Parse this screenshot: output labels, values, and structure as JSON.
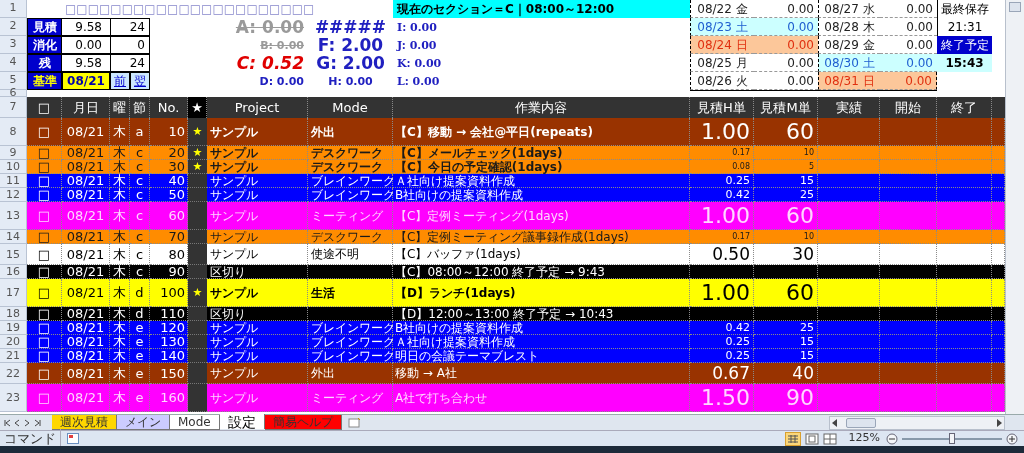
{
  "top_row_numbers": [
    "1",
    "2",
    "3",
    "4",
    "5",
    "6"
  ],
  "checkbox_strip": "□□□□□□□□□□□□□□□□□□□□□□",
  "current_section": "現在のセクション＝C｜08:00～12:00",
  "summary": [
    {
      "label": "見積",
      "hours": "9.58",
      "minutes": "24"
    },
    {
      "label": "消化",
      "hours": "0.00",
      "minutes": "0"
    },
    {
      "label": "残",
      "hours": "9.58",
      "minutes": "24"
    }
  ],
  "base": {
    "label": "基準",
    "date": "08/21",
    "prev": "前",
    "next": "翌"
  },
  "section_totals": [
    [
      {
        "text": "A: 0.00",
        "kind": "done",
        "large": true
      },
      {
        "text": "B: 0.00",
        "kind": "done",
        "large": false
      },
      {
        "text": "C: 0.52",
        "kind": "current",
        "large": true
      },
      {
        "text": "D: 0.00",
        "kind": "pending",
        "large": false
      }
    ],
    [
      {
        "text": "#####",
        "kind": "pending",
        "large": true
      },
      {
        "text": "F: 2.00",
        "kind": "pending",
        "large": true
      },
      {
        "text": "G: 2.00",
        "kind": "pending",
        "large": true
      },
      {
        "text": "H: 0.00",
        "kind": "pending",
        "large": false
      }
    ],
    [
      {
        "text": "I: 0.00",
        "kind": "pending",
        "large": false
      },
      {
        "text": "J: 0.00",
        "kind": "pending",
        "large": false
      },
      {
        "text": "K: 0.00",
        "kind": "pending",
        "large": false
      },
      {
        "text": "L: 0.00",
        "kind": "pending",
        "large": false
      }
    ]
  ],
  "calendar": [
    {
      "date": "08/22 金",
      "value": "0.00",
      "kind": "weekday"
    },
    {
      "date": "08/23 土",
      "value": "0.00",
      "kind": "saturday"
    },
    {
      "date": "08/24 日",
      "value": "0.00",
      "kind": "sunday"
    },
    {
      "date": "08/25 月",
      "value": "0.00",
      "kind": "weekday"
    },
    {
      "date": "08/26 火",
      "value": "0.00",
      "kind": "weekday"
    },
    {
      "date": "08/27 水",
      "value": "0.00",
      "kind": "weekday"
    },
    {
      "date": "08/28 木",
      "value": "0.00",
      "kind": "weekday"
    },
    {
      "date": "08/29 金",
      "value": "0.00",
      "kind": "weekday"
    },
    {
      "date": "08/30 土",
      "value": "0.00",
      "kind": "saturday"
    },
    {
      "date": "08/31 日",
      "value": "0.00",
      "kind": "sunday"
    }
  ],
  "last_saved": {
    "label": "最終保存",
    "time": "21:31"
  },
  "end_estimate": {
    "label": "終了予定",
    "time": "15:43"
  },
  "table": {
    "row_number": "7",
    "columns": [
      "□",
      "月日",
      "曜",
      "節",
      "No.",
      "★",
      "Project",
      "Mode",
      "作業内容",
      "見積H単",
      "見積M単",
      "実績",
      "開始",
      "終了"
    ],
    "rows": [
      {
        "row": "8",
        "check": "□",
        "date": "08/21",
        "dow": "木",
        "sect": "a",
        "no": "10",
        "star": "★",
        "project": "サンプル",
        "mode": "外出",
        "content": "【C】移動 → 会社@平日(repeats)",
        "est_h": "1.00",
        "est_m": "60",
        "kind": "outing",
        "large": true,
        "medium": false,
        "small": false,
        "bold": true
      },
      {
        "row": "9",
        "check": "□",
        "date": "08/21",
        "dow": "木",
        "sect": "c",
        "no": "20",
        "star": "★",
        "project": "サンプル",
        "mode": "デスクワーク",
        "content": "【C】メールチェック(1days)",
        "est_h": "0.17",
        "est_m": "10",
        "kind": "desk",
        "large": false,
        "medium": false,
        "small": true,
        "bold": true
      },
      {
        "row": "10",
        "check": "□",
        "date": "08/21",
        "dow": "木",
        "sect": "c",
        "no": "30",
        "star": "★",
        "project": "サンプル",
        "mode": "デスクワーク",
        "content": "【C】今日の予定確認(1days)",
        "est_h": "0.08",
        "est_m": "5",
        "kind": "desk",
        "large": false,
        "medium": false,
        "small": true,
        "bold": true
      },
      {
        "row": "11",
        "check": "□",
        "date": "08/21",
        "dow": "木",
        "sect": "c",
        "no": "40",
        "project": "サンプル",
        "mode": "ブレインワーク",
        "content": "Ａ社向け提案資料作成",
        "est_h": "0.25",
        "est_m": "15",
        "kind": "brain",
        "large": false,
        "medium": false,
        "small": false,
        "bold": false
      },
      {
        "row": "12",
        "check": "□",
        "date": "08/21",
        "dow": "木",
        "sect": "c",
        "no": "50",
        "project": "サンプル",
        "mode": "ブレインワーク",
        "content": "B社向けの提案資料作成",
        "est_h": "0.42",
        "est_m": "25",
        "kind": "brain",
        "large": false,
        "medium": false,
        "small": false,
        "bold": false
      },
      {
        "row": "13",
        "check": "□",
        "date": "08/21",
        "dow": "木",
        "sect": "c",
        "no": "60",
        "project": "サンプル",
        "mode": "ミーティング",
        "content": "【C】定例ミーティング(1days)",
        "est_h": "1.00",
        "est_m": "60",
        "kind": "meeting",
        "large": true,
        "medium": false,
        "small": false,
        "bold": false
      },
      {
        "row": "14",
        "check": "□",
        "date": "08/21",
        "dow": "木",
        "sect": "c",
        "no": "70",
        "project": "サンプル",
        "mode": "デスクワーク",
        "content": "【C】定例ミーティング議事録作成(1days)",
        "est_h": "0.17",
        "est_m": "10",
        "kind": "desk",
        "large": false,
        "medium": false,
        "small": true,
        "bold": false
      },
      {
        "row": "15",
        "check": "□",
        "date": "08/21",
        "dow": "木",
        "sect": "c",
        "no": "80",
        "project": "サンプル",
        "mode": "使途不明",
        "content": "【C】バッファ(1days)",
        "est_h": "0.50",
        "est_m": "30",
        "kind": "misc",
        "large": false,
        "medium": true,
        "small": false,
        "bold": false
      },
      {
        "row": "16",
        "check": "□",
        "date": "08/21",
        "dow": "木",
        "sect": "c",
        "no": "90",
        "project": "区切り",
        "content": "【C】08:00～12:00 終了予定 → 9:43",
        "kind": "separator",
        "bold": false
      },
      {
        "row": "17",
        "check": "□",
        "date": "08/21",
        "dow": "木",
        "sect": "d",
        "no": "100",
        "star": "★",
        "project": "サンプル",
        "mode": "生活",
        "content": "【D】ランチ(1days)",
        "est_h": "1.00",
        "est_m": "60",
        "kind": "life",
        "large": true,
        "medium": false,
        "small": false,
        "bold": true
      },
      {
        "row": "18",
        "check": "□",
        "date": "08/21",
        "dow": "木",
        "sect": "d",
        "no": "110",
        "project": "区切り",
        "content": "【D】12:00～13:00 終了予定 → 10:43",
        "kind": "separator",
        "bold": false
      },
      {
        "row": "19",
        "check": "□",
        "date": "08/21",
        "dow": "木",
        "sect": "e",
        "no": "120",
        "project": "サンプル",
        "mode": "ブレインワーク",
        "content": "B社向けの提案資料作成",
        "est_h": "0.42",
        "est_m": "25",
        "kind": "brain",
        "large": false,
        "medium": false,
        "small": false,
        "bold": false
      },
      {
        "row": "20",
        "check": "□",
        "date": "08/21",
        "dow": "木",
        "sect": "e",
        "no": "130",
        "project": "サンプル",
        "mode": "ブレインワーク",
        "content": "Ａ社向け提案資料作成",
        "est_h": "0.25",
        "est_m": "15",
        "kind": "brain",
        "large": false,
        "medium": false,
        "small": false,
        "bold": false
      },
      {
        "row": "21",
        "check": "□",
        "date": "08/21",
        "dow": "木",
        "sect": "e",
        "no": "140",
        "project": "サンプル",
        "mode": "ブレインワーク",
        "content": "明日の会議テーマブレスト",
        "est_h": "0.25",
        "est_m": "15",
        "kind": "brain",
        "large": false,
        "medium": false,
        "small": false,
        "bold": false
      },
      {
        "row": "22",
        "check": "□",
        "date": "08/21",
        "dow": "木",
        "sect": "e",
        "no": "150",
        "project": "サンプル",
        "mode": "外出",
        "content": "移動 → A社",
        "est_h": "0.67",
        "est_m": "40",
        "kind": "outing",
        "large": false,
        "medium": true,
        "small": false,
        "bold": false
      },
      {
        "row": "23",
        "check": "□",
        "date": "08/21",
        "dow": "木",
        "sect": "e",
        "no": "160",
        "project": "サンプル",
        "mode": "ミーティング",
        "content": "A社で打ち合わせ",
        "est_h": "1.50",
        "est_m": "90",
        "kind": "meeting",
        "large": true,
        "medium": false,
        "small": false,
        "bold": false
      }
    ]
  },
  "sheet_tabs": [
    {
      "label": "週次見積",
      "color": "#ffd700",
      "selected": false
    },
    {
      "label": "メイン",
      "color": "#ccccff",
      "selected": false
    },
    {
      "label": "Mode",
      "color": "#ffffff",
      "selected": false
    },
    {
      "label": "設定",
      "color": "#ffffff",
      "selected": true
    },
    {
      "label": "簡易ヘルプ",
      "color": "#ff0000",
      "selected": false
    }
  ],
  "status_bar": {
    "mode": "コマンド",
    "zoom": "125%",
    "zoom_slider": {
      "level": 0.5
    }
  }
}
